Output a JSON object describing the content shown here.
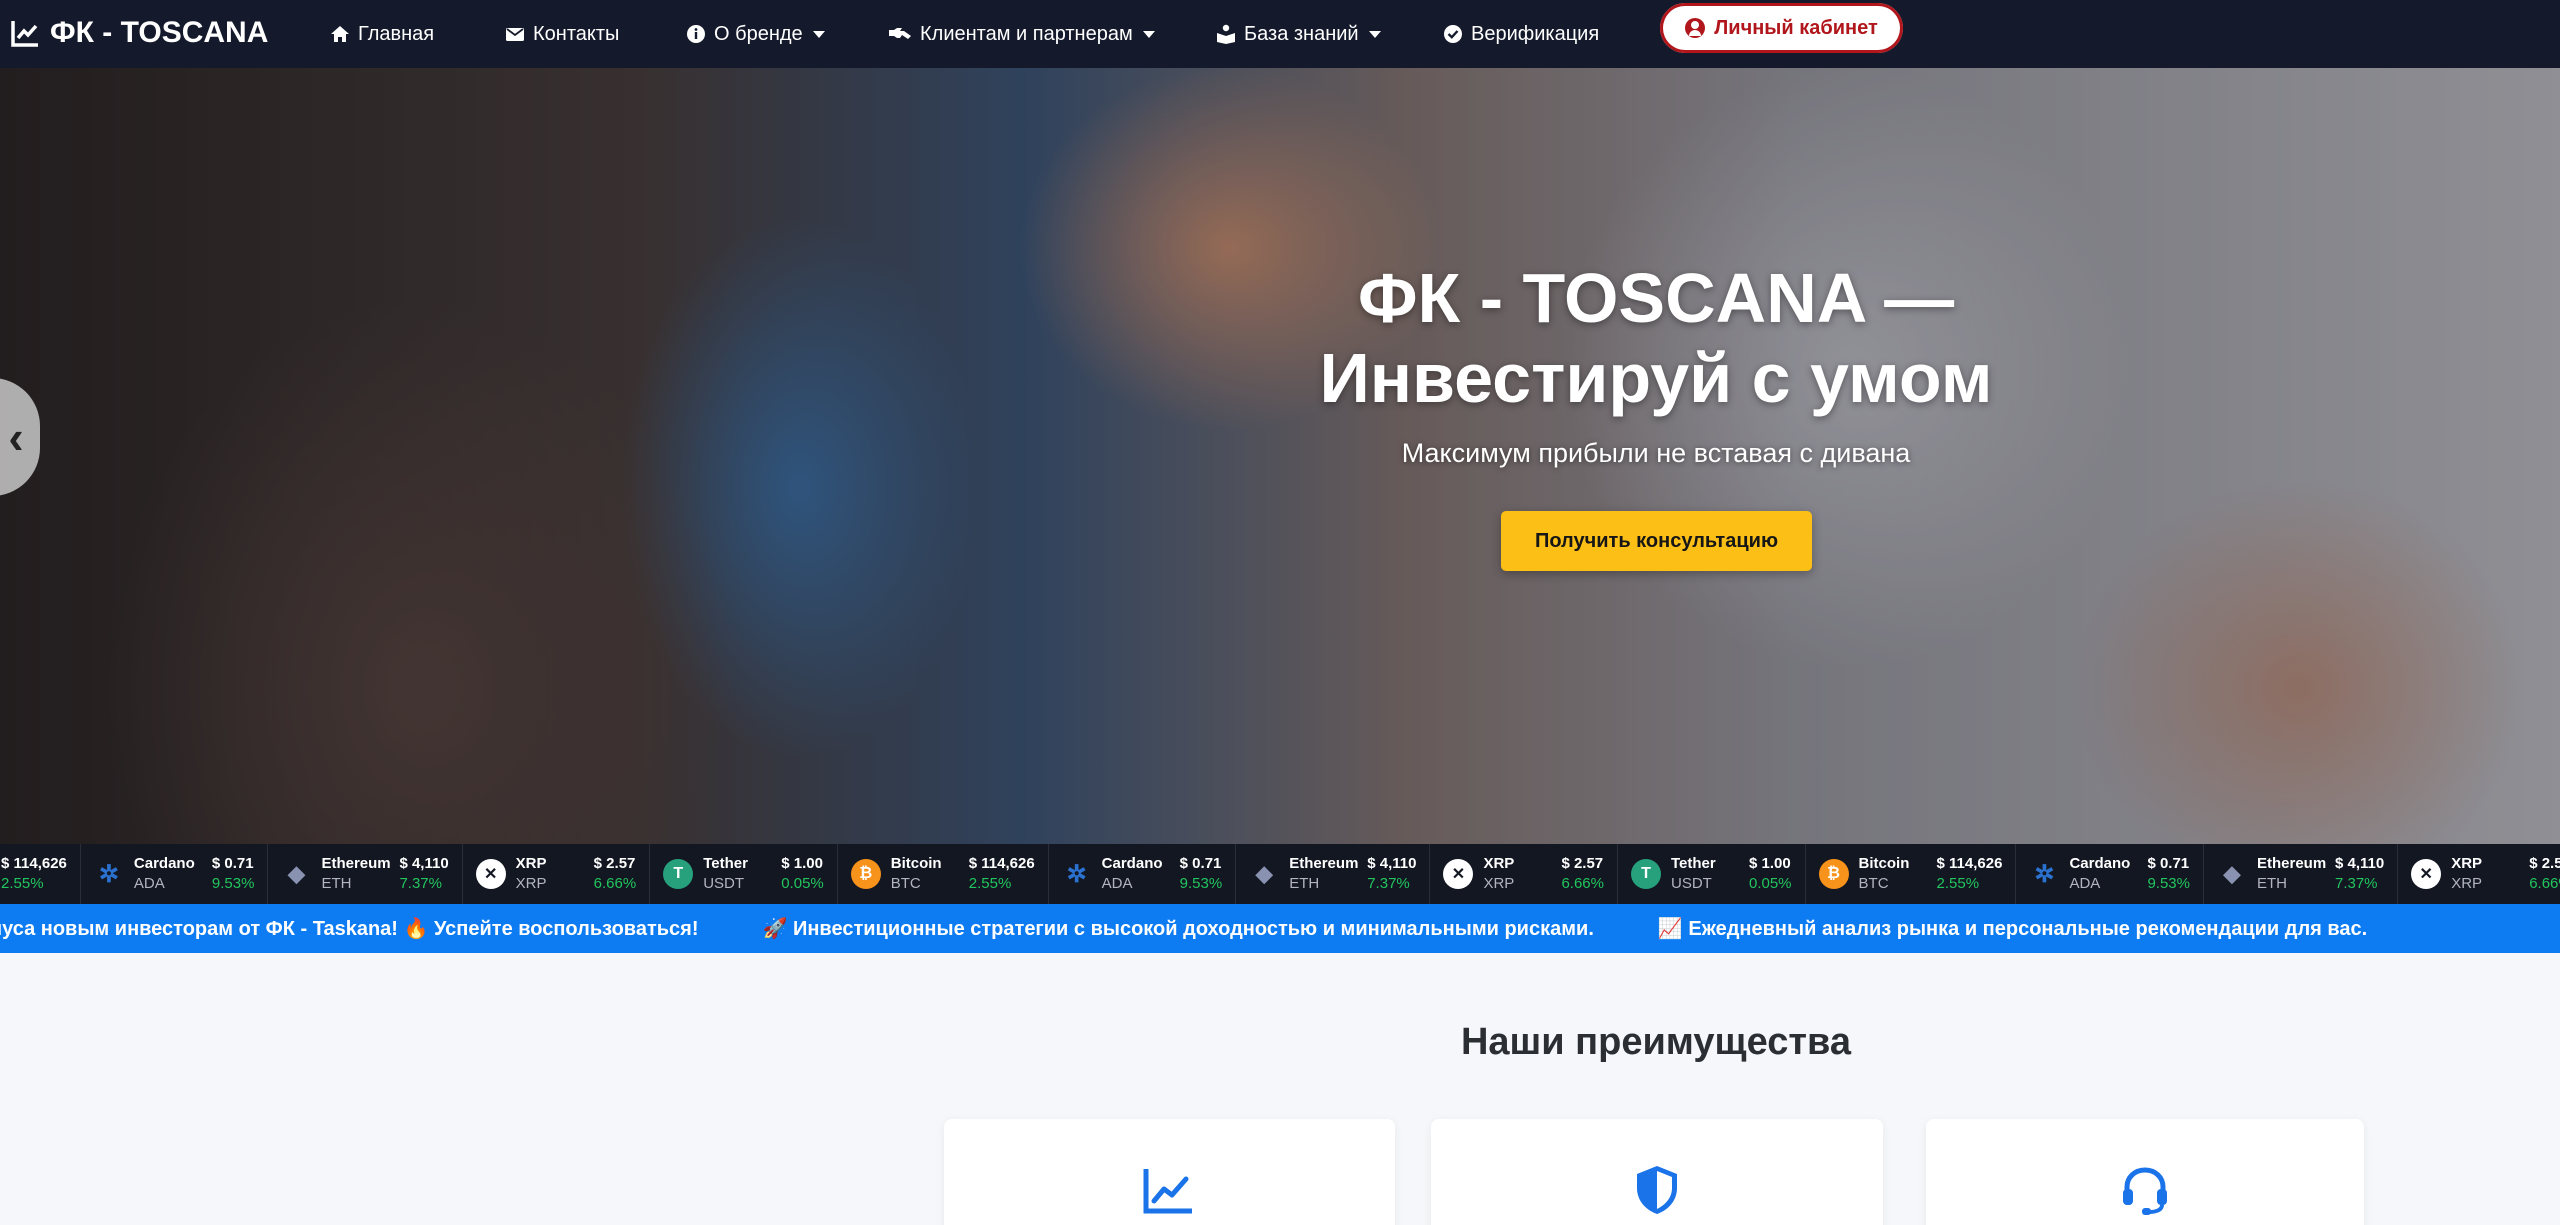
{
  "brand": {
    "name": "ФК - TOSCANA"
  },
  "nav": {
    "items": [
      {
        "label": "Главная",
        "icon": "home-icon"
      },
      {
        "label": "Контакты",
        "icon": "envelope-icon"
      },
      {
        "label": "О бренде",
        "icon": "info-icon",
        "dropdown": true
      },
      {
        "label": "Клиентам и партнерам",
        "icon": "handshake-icon",
        "dropdown": true
      },
      {
        "label": "База знаний",
        "icon": "book-reader-icon",
        "dropdown": true
      },
      {
        "label": "Верификация",
        "icon": "check-circle-icon"
      }
    ],
    "cabinet_label": "Личный кабинет"
  },
  "hero": {
    "title_line1": "ФК - TOSCANA —",
    "title_line2": "Инвестируй с умом",
    "subtitle": "Максимум прибыли не вставая с дивана",
    "cta_label": "Получить консультацию",
    "prev_label": "‹"
  },
  "ticker": {
    "coins": [
      {
        "name": "Bitcoin",
        "symbol": "BTC",
        "price": "$ 114,626",
        "change": "2.55%",
        "icon": "bitcoin-icon",
        "color": "#f7931a"
      },
      {
        "name": "Cardano",
        "symbol": "ADA",
        "price": "$ 0.71",
        "change": "9.53%",
        "icon": "cardano-icon",
        "color": "#2a71d0"
      },
      {
        "name": "Ethereum",
        "symbol": "ETH",
        "price": "$ 4,110",
        "change": "7.37%",
        "icon": "ethereum-icon",
        "color": "#8a92b2"
      },
      {
        "name": "XRP",
        "symbol": "XRP",
        "price": "$ 2.57",
        "change": "6.66%",
        "icon": "xrp-icon",
        "color": "#ffffff"
      },
      {
        "name": "Tether",
        "symbol": "USDT",
        "price": "$ 1.00",
        "change": "0.05%",
        "icon": "tether-icon",
        "color": "#26a17b"
      }
    ],
    "change_color": "#22c55e"
  },
  "news": {
    "items": [
      "нуса новым инвесторам от ФК - Taskana! 🔥 Успейте воспользоваться!",
      "🚀 Инвестиционные стратегии с высокой доходностью и минимальными рисками.",
      "📈 Ежедневный анализ рынка и персональные рекомендации для вас."
    ]
  },
  "advantages": {
    "title": "Наши преимущества",
    "cards": [
      {
        "icon": "chart-line-icon"
      },
      {
        "icon": "shield-icon"
      },
      {
        "icon": "headset-icon"
      }
    ]
  },
  "colors": {
    "nav_bg": "#141a2b",
    "accent_red": "#b0161b",
    "cta_yellow": "#fbbf16",
    "news_blue": "#0d7bf2",
    "icon_blue": "#1a73e8"
  }
}
